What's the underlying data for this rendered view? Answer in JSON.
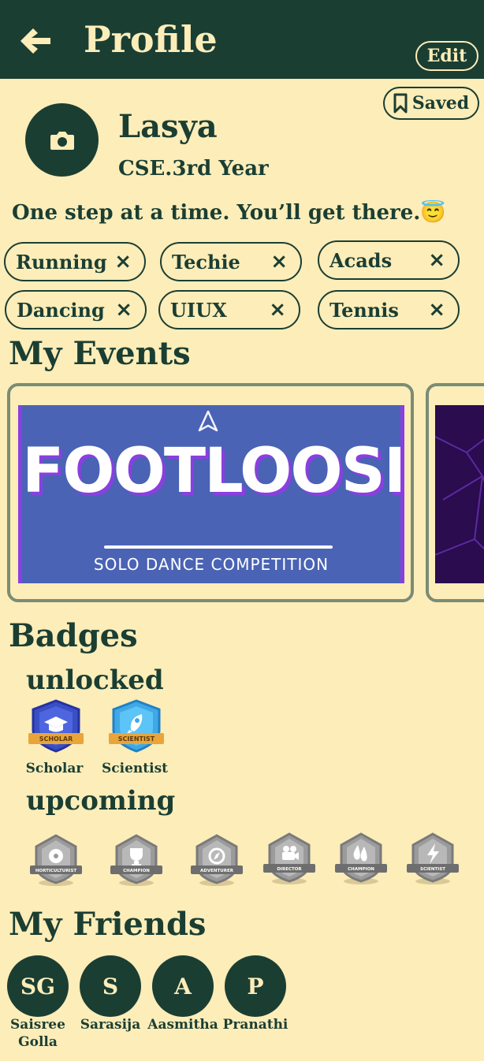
{
  "header": {
    "title": "Profile",
    "edit_label": "Edit"
  },
  "saved_label": "Saved",
  "profile": {
    "name": "Lasya",
    "year": "CSE.3rd Year",
    "bio": "One step at a time. You’ll get there.😇"
  },
  "tags": [
    "Running",
    "Techie",
    "Acads",
    "Dancing",
    "UIUX",
    "Tennis"
  ],
  "remove_icon": "×",
  "events": {
    "heading": "My Events",
    "items": [
      {
        "title": "FOOTLOOSE",
        "subtitle": "SOLO DANCE COMPETITION"
      }
    ]
  },
  "badges": {
    "heading": "Badges",
    "unlocked_heading": "unlocked",
    "unlocked": [
      {
        "name": "Scholar",
        "ribbon": "SCHOLAR",
        "icon": "graduation-cap-icon"
      },
      {
        "name": "Scientist",
        "ribbon": "SCIENTIST",
        "icon": "rocket-icon"
      }
    ],
    "upcoming_heading": "upcoming",
    "upcoming": [
      {
        "ribbon": "HORTICULTURIST",
        "icon": "flower-icon"
      },
      {
        "ribbon": "CHAMPION",
        "icon": "trophy-icon"
      },
      {
        "ribbon": "ADVENTURER",
        "icon": "compass-icon"
      },
      {
        "ribbon": "DIRECTOR",
        "icon": "camera-icon"
      },
      {
        "ribbon": "CHAMPION",
        "icon": "drop-icon"
      },
      {
        "ribbon": "SCIENTIST",
        "icon": "bolt-icon"
      }
    ]
  },
  "friends": {
    "heading": "My Friends",
    "items": [
      {
        "initials": "SG",
        "name": "Saisree Golla"
      },
      {
        "initials": "S",
        "name": "Sarasija"
      },
      {
        "initials": "A",
        "name": "Aasmitha"
      },
      {
        "initials": "P",
        "name": "Pranathi"
      }
    ]
  },
  "colors": {
    "background": "#fcedb9",
    "primary": "#1b3e33",
    "card_border": "#7a8c74",
    "badge_blue": "#3a4fc4",
    "badge_cyan": "#3fa9e8",
    "ribbon_gold": "#e9a43a",
    "badge_grey": "#9b9b9b"
  }
}
